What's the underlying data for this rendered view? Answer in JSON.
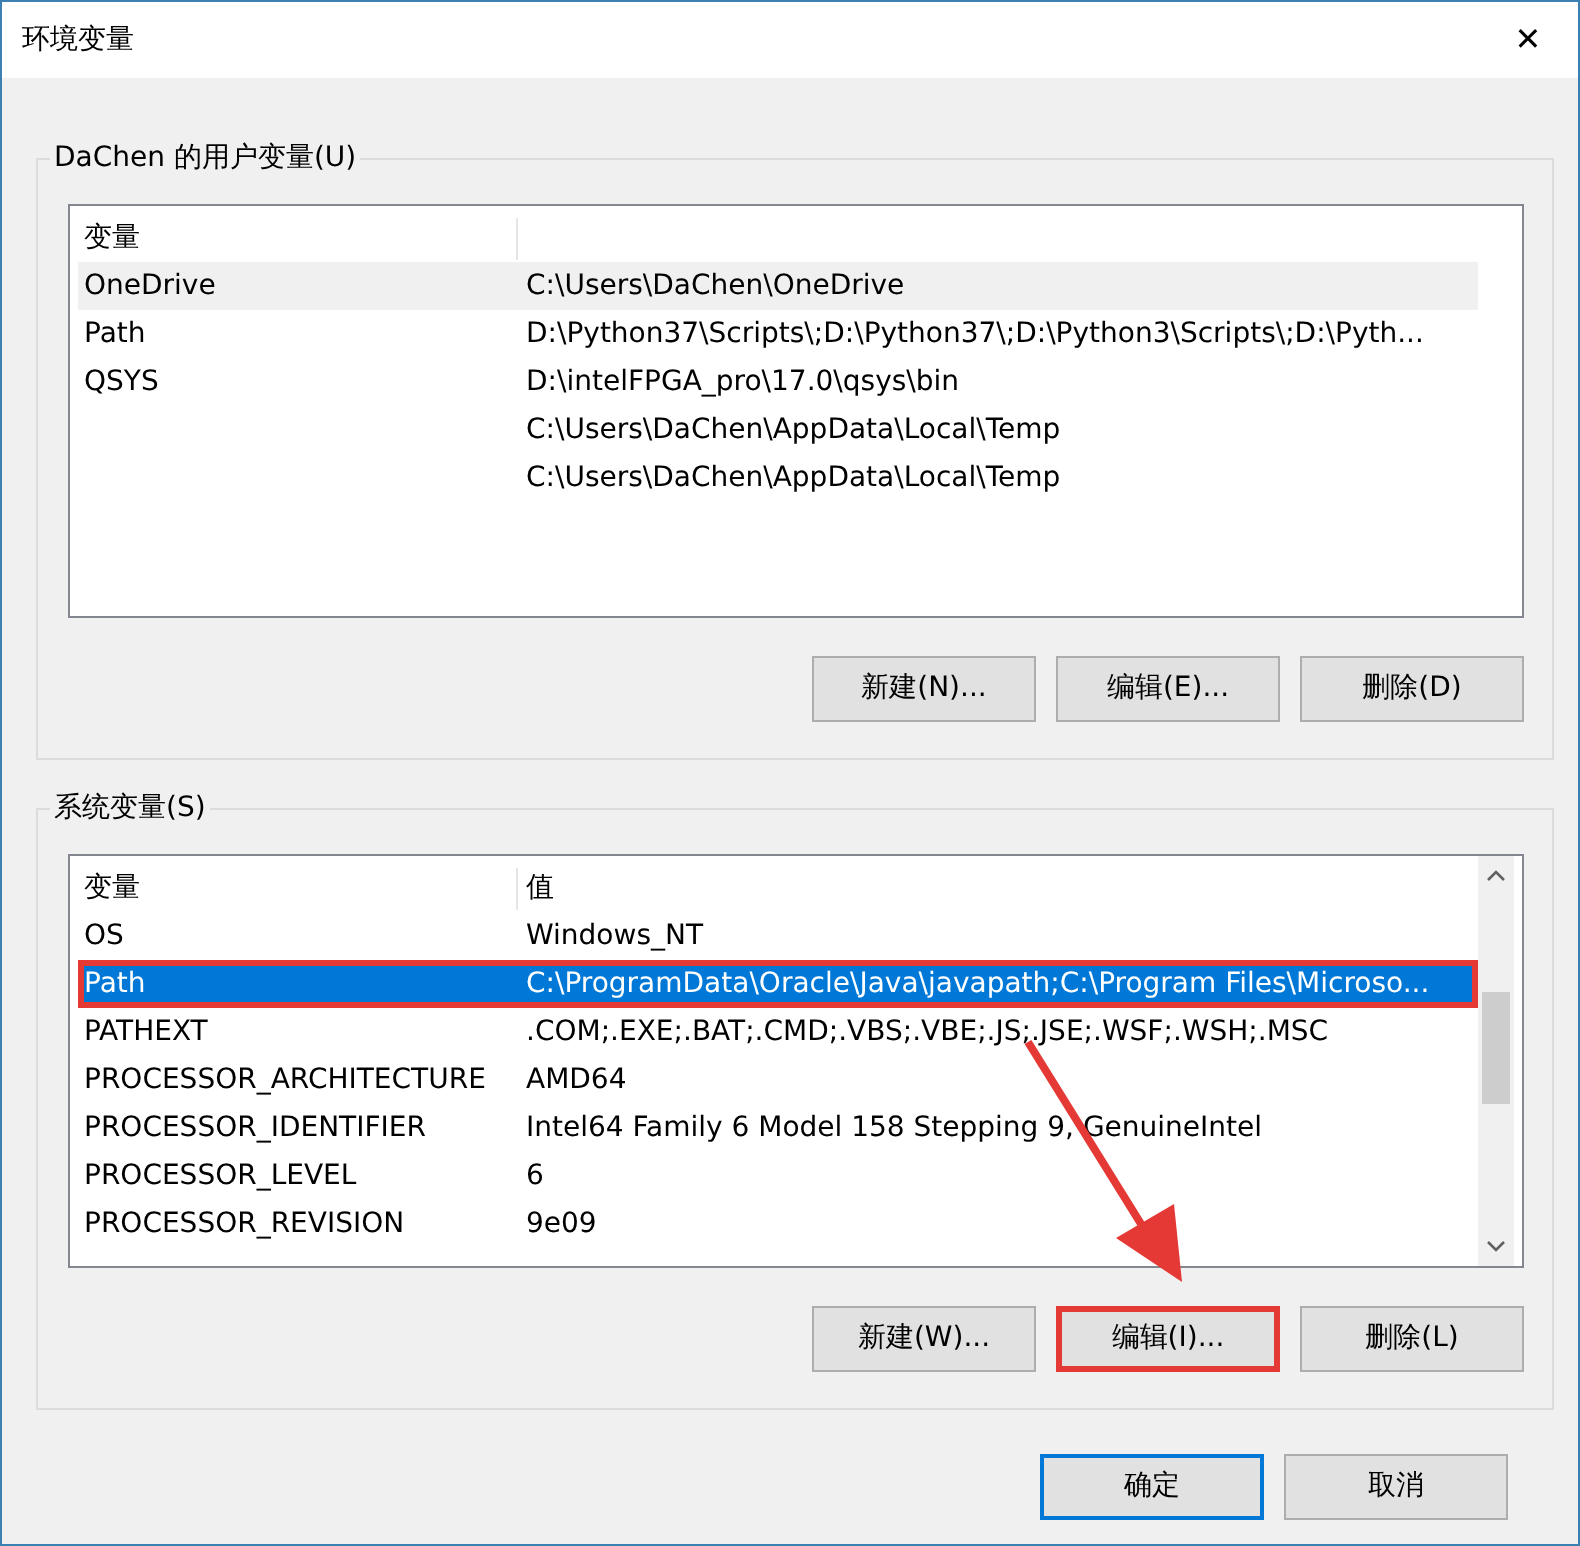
{
  "window": {
    "title": "环境变量",
    "close": "✕"
  },
  "user_vars": {
    "legend": "DaChen 的用户变量(U)",
    "columns": [
      "变量"
    ],
    "focused": false,
    "rows": [
      {
        "name": "OneDrive",
        "value": "C:\\Users\\DaChen\\OneDrive",
        "selected": true,
        "highlighted": false
      },
      {
        "name": "Path",
        "value": "D:\\Python37\\Scripts\\;D:\\Python37\\;D:\\Python3\\Scripts\\;D:\\Pyth...",
        "selected": false,
        "highlighted": false
      },
      {
        "name": "QSYS",
        "value": "D:\\intelFPGA_pro\\17.0\\qsys\\bin",
        "selected": false,
        "highlighted": false
      },
      {
        "value": "C:\\Users\\DaChen\\AppData\\Local\\Temp",
        "selected": false,
        "highlighted": false
      },
      {
        "value": "C:\\Users\\DaChen\\AppData\\Local\\Temp",
        "selected": false,
        "highlighted": false
      }
    ],
    "buttons": [
      {
        "label": "新建(N)...",
        "highlighted": false
      },
      {
        "label": "编辑(E)...",
        "highlighted": false
      },
      {
        "label": "删除(D)",
        "highlighted": false
      }
    ]
  },
  "system_vars": {
    "legend": "系统变量(S)",
    "columns": [
      "变量",
      "值"
    ],
    "focused": true,
    "rows": [
      {
        "name": "OS",
        "value": "Windows_NT",
        "selected": false,
        "highlighted": false
      },
      {
        "name": "Path",
        "value": "C:\\ProgramData\\Oracle\\Java\\javapath;C:\\Program Files\\Microso...",
        "selected": true,
        "highlighted": true
      },
      {
        "name": "PATHEXT",
        "value": ".COM;.EXE;.BAT;.CMD;.VBS;.VBE;.JS;.JSE;.WSF;.WSH;.MSC",
        "selected": false,
        "highlighted": false
      },
      {
        "name": "PROCESSOR_ARCHITECTURE",
        "value": "AMD64",
        "selected": false,
        "highlighted": false
      },
      {
        "name": "PROCESSOR_IDENTIFIER",
        "value": "Intel64 Family 6 Model 158 Stepping 9, GenuineIntel",
        "selected": false,
        "highlighted": false
      },
      {
        "name": "PROCESSOR_LEVEL",
        "value": "6",
        "selected": false,
        "highlighted": false
      },
      {
        "name": "PROCESSOR_REVISION",
        "value": "9e09",
        "selected": false,
        "highlighted": false
      }
    ],
    "buttons": [
      {
        "label": "新建(W)...",
        "highlighted": false
      },
      {
        "label": "编辑(I)...",
        "highlighted": true
      },
      {
        "label": "删除(L)",
        "highlighted": false
      }
    ]
  },
  "footer_buttons": [
    {
      "label": "确定",
      "default": true
    },
    {
      "label": "取消",
      "default": false
    }
  ]
}
